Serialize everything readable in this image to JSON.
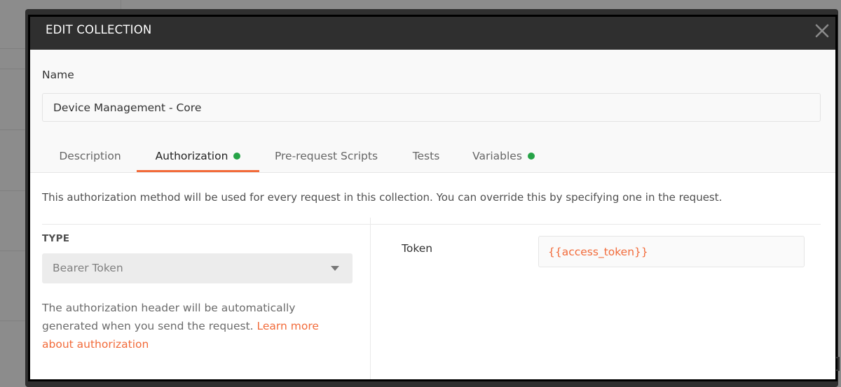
{
  "modal": {
    "title": "EDIT COLLECTION",
    "close_icon": "close-icon"
  },
  "name_field": {
    "label": "Name",
    "value": "Device Management - Core"
  },
  "tabs": [
    {
      "label": "Description",
      "active": false,
      "has_dot": false
    },
    {
      "label": "Authorization",
      "active": true,
      "has_dot": true
    },
    {
      "label": "Pre-request Scripts",
      "active": false,
      "has_dot": false
    },
    {
      "label": "Tests",
      "active": false,
      "has_dot": false
    },
    {
      "label": "Variables",
      "active": false,
      "has_dot": true
    }
  ],
  "authorization": {
    "info": "This authorization method will be used for every request in this collection. You can override this by specifying one in the request.",
    "type_label": "TYPE",
    "type_value": "Bearer Token",
    "help_text": "The authorization header will be automatically generated when you send the request. ",
    "help_link": "Learn more about authorization",
    "token_label": "Token",
    "token_value": "{{access_token}}"
  },
  "colors": {
    "accent": "#f26b3a",
    "status_dot": "#26a347",
    "header_bg": "#2f2f2f"
  }
}
